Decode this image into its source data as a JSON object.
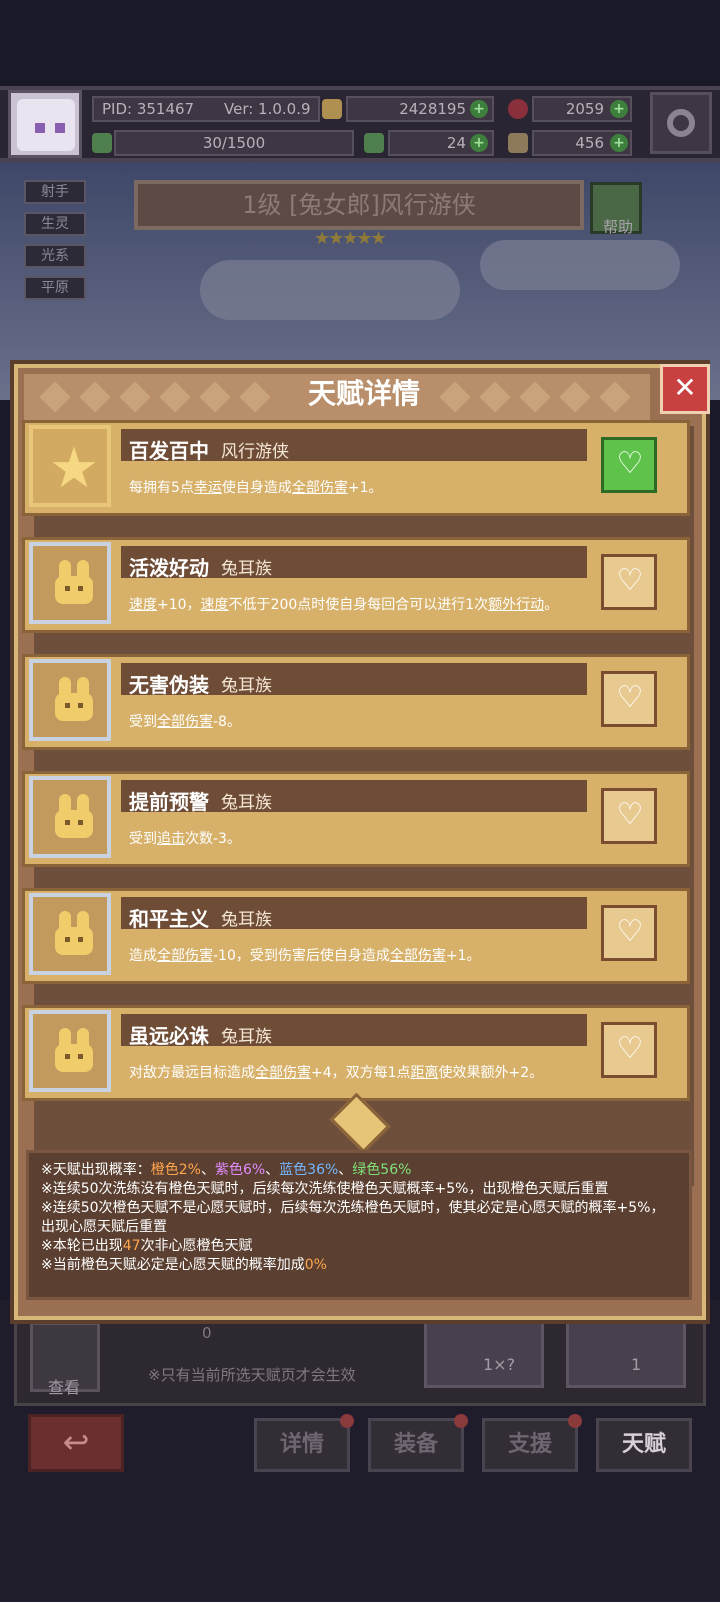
{
  "header": {
    "pid": "PID: 351467",
    "version": "Ver: 1.0.0.9",
    "gold": "2428195",
    "gems": "2059",
    "energy": "30/1500",
    "clover": "24",
    "scroll": "456"
  },
  "tags": [
    "射手",
    "生灵",
    "光系",
    "平原"
  ],
  "hero": {
    "title": "1级 [兔女郎]风行游侠",
    "help": "帮助"
  },
  "modal": {
    "title": "天赋详情",
    "talents": [
      {
        "name": "百发百中",
        "tribe": "风行游侠",
        "desc_pre": "每拥有5点",
        "u1": "幸运",
        "desc_mid": "使自身造成",
        "u2": "全部伤害",
        "desc_post": "+1。"
      },
      {
        "name": "活泼好动",
        "tribe": "兔耳族",
        "desc_pre": "",
        "u1": "速度",
        "desc_mid": "+10，",
        "u2": "速度",
        "desc_post": "不低于200点时使自身每回合可以进行1次",
        "u3": "额外行动",
        "desc_end": "。"
      },
      {
        "name": "无害伪装",
        "tribe": "兔耳族",
        "desc_pre": "受到",
        "u1": "全部伤害",
        "desc_mid": "-8。",
        "u2": "",
        "desc_post": ""
      },
      {
        "name": "提前预警",
        "tribe": "兔耳族",
        "desc_pre": "受到",
        "u1": "追击",
        "desc_mid": "次数-3。",
        "u2": "",
        "desc_post": ""
      },
      {
        "name": "和平主义",
        "tribe": "兔耳族",
        "desc_pre": "造成",
        "u1": "全部伤害",
        "desc_mid": "-10，受到伤害后使自身造成",
        "u2": "全部伤害",
        "desc_post": "+1。"
      },
      {
        "name": "虽远必诛",
        "tribe": "兔耳族",
        "desc_pre": "对敌方最远目标造成",
        "u1": "全部伤害",
        "desc_mid": "+4，双方每1点",
        "u2": "距离",
        "desc_post": "使效果额外+2。"
      }
    ]
  },
  "info": {
    "l1_pre": "※天赋出现概率：",
    "orange": "橙色2%",
    "sep1": "、",
    "purple": "紫色6%",
    "sep2": "、",
    "blue": "蓝色36%",
    "sep3": "、",
    "green": "绿色56%",
    "l2": "※连续50次洗练没有橙色天赋时，后续每次洗练使橙色天赋概率+5%，出现橙色天赋后重置",
    "l3": "※连续50次橙色天赋不是心愿天赋时，后续每次洗练橙色天赋时，使其必定是心愿天赋的概率+5%，出现心愿天赋后重置",
    "l4_pre": "※本轮已出现",
    "l4_num": "47",
    "l4_post": "次非心愿橙色天赋",
    "l5_pre": "※当前橙色天赋必定是心愿天赋的概率加成",
    "l5_num": "0%"
  },
  "bottom": {
    "count": "0",
    "search": "查看",
    "note": "※只有当前所选天赋页才会生效",
    "auto_count": "1×?",
    "refine_count": "1",
    "nav": [
      "详情",
      "装备",
      "支援",
      "天赋"
    ]
  }
}
